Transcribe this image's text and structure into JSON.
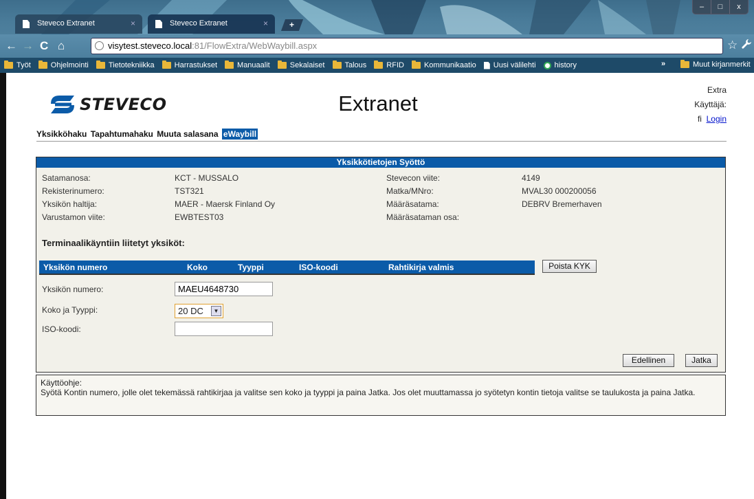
{
  "browser": {
    "tabs": [
      {
        "label": "Steveco Extranet",
        "close": "×"
      },
      {
        "label": "Steveco Extranet",
        "close": "×"
      }
    ],
    "new_tab": "+",
    "window_controls": {
      "minimize": "–",
      "maximize": "□",
      "close": "x"
    },
    "nav": {
      "back": "←",
      "forward": "→",
      "reload": "C",
      "home": "⌂"
    },
    "url": {
      "host": "visytest.steveco.local",
      "rest": ":81/FlowExtra/WebWaybill.aspx"
    },
    "star": "☆",
    "wrench": "🔧",
    "bookmarks": [
      {
        "label": "Työt",
        "icon": "folder-icon"
      },
      {
        "label": "Ohjelmointi",
        "icon": "folder-icon"
      },
      {
        "label": "Tietotekniikka",
        "icon": "folder-icon"
      },
      {
        "label": "Harrastukset",
        "icon": "folder-icon"
      },
      {
        "label": "Manuaalit",
        "icon": "folder-icon"
      },
      {
        "label": "Sekalaiset",
        "icon": "folder-icon"
      },
      {
        "label": "Talous",
        "icon": "folder-icon"
      },
      {
        "label": "RFID",
        "icon": "folder-icon"
      },
      {
        "label": "Kommunikaatio",
        "icon": "folder-icon"
      },
      {
        "label": "Uusi välilehti",
        "icon": "page-icon"
      },
      {
        "label": "history",
        "icon": "history-icon"
      }
    ],
    "bookmarks_more": "»",
    "other_bookmarks": "Muut kirjanmerkit"
  },
  "header": {
    "logo_text": "STEVECO",
    "title": "Extranet",
    "extra": "Extra",
    "user_label": "Käyttäjä:",
    "lang": "fi",
    "login": "Login"
  },
  "menu": [
    {
      "label": "Yksikköhaku",
      "active": false
    },
    {
      "label": "Tapahtumahaku",
      "active": false
    },
    {
      "label": "Muuta salasana",
      "active": false
    },
    {
      "label": "eWaybill",
      "active": true
    }
  ],
  "panel": {
    "title": "Yksikkötietojen Syöttö",
    "left_fields": [
      {
        "label": "Satamanosa:",
        "value": "KCT - MUSSALO"
      },
      {
        "label": "Rekisterinumero:",
        "value": "TST321"
      },
      {
        "label": "Yksikön haltija:",
        "value": "MAER - Maersk Finland Oy"
      },
      {
        "label": "Varustamon viite:",
        "value": "EWBTEST03"
      }
    ],
    "right_fields": [
      {
        "label": "Stevecon viite:",
        "value": "4149"
      },
      {
        "label": "Matka/MNro:",
        "value": "MVAL30 000200056"
      },
      {
        "label": "Määräsatama:",
        "value": "DEBRV Bremerhaven"
      },
      {
        "label": "Määräsataman osa:",
        "value": ""
      }
    ],
    "units_heading": "Terminaalikäyntiin liitetyt yksiköt:",
    "table_columns": [
      "Yksikön numero",
      "Koko",
      "Tyyppi",
      "ISO-koodi",
      "Rahtikirja valmis"
    ],
    "remove_button": "Poista KYK",
    "form": {
      "unit_number_label": "Yksikön numero:",
      "unit_number_value": "MAEU4648730",
      "size_type_label": "Koko ja Tyyppi:",
      "size_type_value": "20 DC",
      "iso_label": "ISO-koodi:",
      "iso_value": ""
    },
    "prev_button": "Edellinen",
    "next_button": "Jatka"
  },
  "help": {
    "title": "Käyttöohje:",
    "text": "Syötä Kontin numero, jolle olet tekemässä rahtikirjaa ja valitse sen koko ja tyyppi ja paina Jatka. Jos olet muuttamassa jo syötetyn kontin tietoja valitse se taulukosta ja paina Jatka."
  },
  "colors": {
    "accent": "#0b5ba8",
    "panel_bg": "#f2f1ea",
    "link": "#0011cc"
  }
}
